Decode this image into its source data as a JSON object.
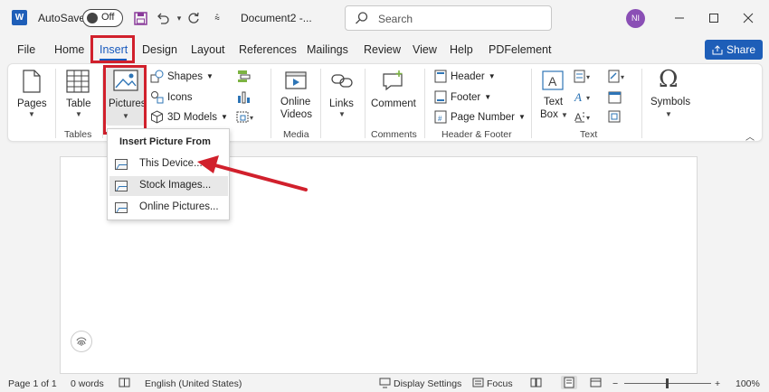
{
  "titlebar": {
    "app_logo": "W",
    "autosave_label": "AutoSave",
    "autosave_state": "Off",
    "document_title": "Document2  -...",
    "search_placeholder": "Search",
    "user_initials": "NI"
  },
  "tabs": [
    {
      "label": "File"
    },
    {
      "label": "Home"
    },
    {
      "label": "Insert"
    },
    {
      "label": "Design"
    },
    {
      "label": "Layout"
    },
    {
      "label": "References"
    },
    {
      "label": "Mailings"
    },
    {
      "label": "Review"
    },
    {
      "label": "View"
    },
    {
      "label": "Help"
    },
    {
      "label": "PDFelement"
    }
  ],
  "share_label": "Share",
  "ribbon": {
    "pages": "Pages",
    "table": "Table",
    "tables_group": "Tables",
    "pictures": "Pictures",
    "shapes": "Shapes",
    "icons": "Icons",
    "models_3d": "3D Models",
    "online_videos_1": "Online",
    "online_videos_2": "Videos",
    "media_group": "Media",
    "links": "Links",
    "comment": "Comment",
    "comments_group": "Comments",
    "header": "Header",
    "footer": "Footer",
    "page_number": "Page Number",
    "header_footer_group": "Header & Footer",
    "text_box_1": "Text",
    "text_box_2": "Box",
    "text_group": "Text",
    "symbols": "Symbols"
  },
  "dropdown": {
    "header": "Insert Picture From",
    "items": [
      {
        "label": "This Device..."
      },
      {
        "label": "Stock Images..."
      },
      {
        "label": "Online Pictures..."
      }
    ]
  },
  "statusbar": {
    "page": "Page 1 of 1",
    "words": "0 words",
    "language": "English (United States)",
    "display_settings": "Display Settings",
    "focus": "Focus",
    "zoom": "100%"
  },
  "colors": {
    "accent": "#185abd",
    "highlight": "#d1202c"
  }
}
